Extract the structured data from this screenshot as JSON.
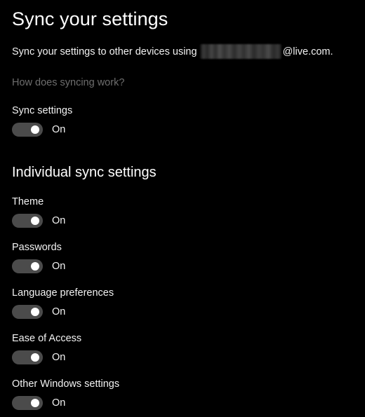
{
  "page": {
    "title": "Sync your settings",
    "background_color": "#000000",
    "text_color": "#f2f2f2"
  },
  "description": {
    "prefix": "Sync your settings to other devices using",
    "redacted_account": "",
    "suffix": "@live.com."
  },
  "help_link": {
    "label": "How does syncing work?",
    "color": "#6e6e6e"
  },
  "master_setting": {
    "label": "Sync settings",
    "state": "On",
    "toggle_on": true
  },
  "individual_section": {
    "heading": "Individual sync settings",
    "items": [
      {
        "label": "Theme",
        "state": "On",
        "toggle_on": true
      },
      {
        "label": "Passwords",
        "state": "On",
        "toggle_on": true
      },
      {
        "label": "Language preferences",
        "state": "On",
        "toggle_on": true
      },
      {
        "label": "Ease of Access",
        "state": "On",
        "toggle_on": true
      },
      {
        "label": "Other Windows settings",
        "state": "On",
        "toggle_on": true
      }
    ]
  },
  "theme": {
    "toggle_track_color": "#4b4b4b",
    "toggle_knob_color": "#ffffff",
    "accent_color": "#ffffff"
  }
}
